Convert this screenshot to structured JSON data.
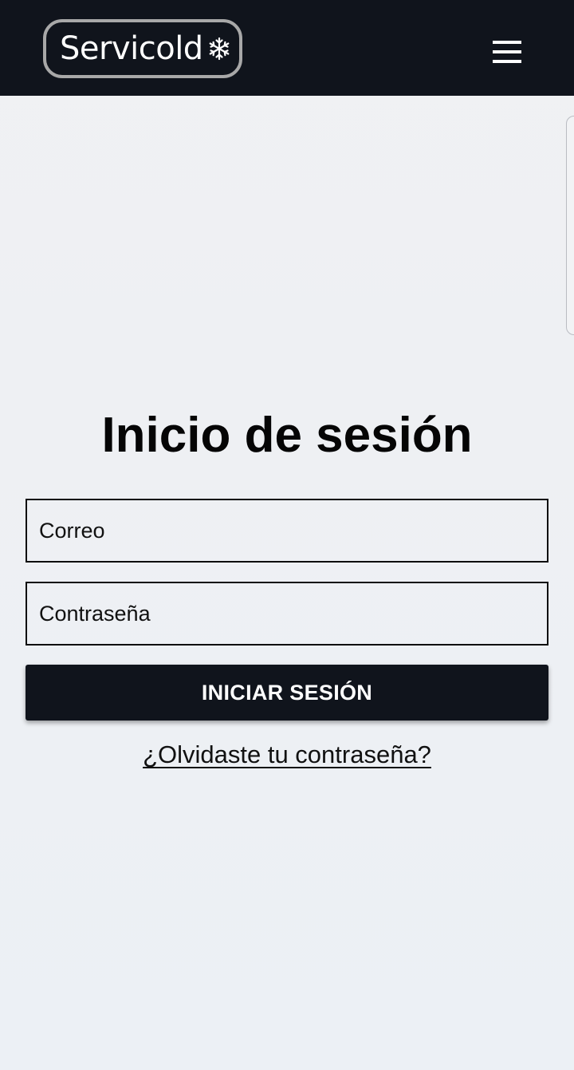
{
  "header": {
    "logo_text": "Servicold",
    "logo_icon": "snowflake-icon",
    "menu_icon": "hamburger-menu-icon",
    "background_color": "#10141c"
  },
  "login": {
    "title": "Inicio de sesión",
    "email_placeholder": "Correo",
    "email_value": "",
    "password_placeholder": "Contraseña",
    "password_value": "",
    "submit_label": "INICIAR SESIÓN",
    "forgot_link": "¿Olvidaste tu contraseña?"
  }
}
